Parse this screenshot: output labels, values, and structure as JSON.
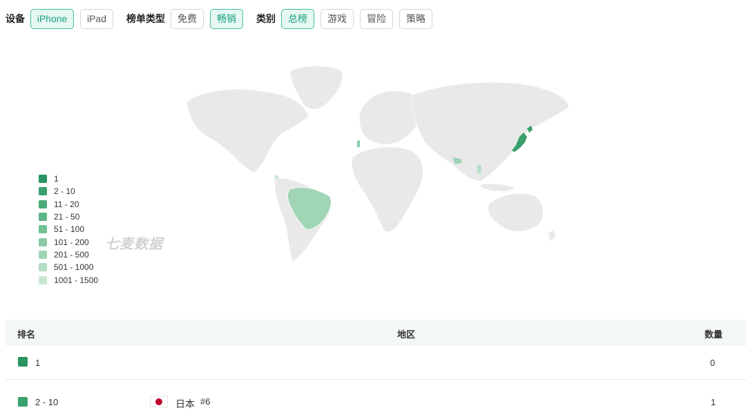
{
  "filters": {
    "device": {
      "label": "设备",
      "options": [
        "iPhone",
        "iPad"
      ],
      "selected": "iPhone"
    },
    "chart_type": {
      "label": "榜单类型",
      "options": [
        "免费",
        "畅销"
      ],
      "selected": "畅销"
    },
    "category": {
      "label": "类别",
      "options": [
        "总榜",
        "游戏",
        "冒险",
        "策略"
      ],
      "selected": "总榜"
    }
  },
  "legend": [
    {
      "label": "1",
      "color": "#2a9460"
    },
    {
      "label": "2 - 10",
      "color": "#3aa06c"
    },
    {
      "label": "11 - 20",
      "color": "#4aa977"
    },
    {
      "label": "21 - 50",
      "color": "#5db584"
    },
    {
      "label": "51 - 100",
      "color": "#73c095"
    },
    {
      "label": "101 - 200",
      "color": "#8acba5"
    },
    {
      "label": "201 - 500",
      "color": "#a0d5b6"
    },
    {
      "label": "501 - 1000",
      "color": "#b3dec5"
    },
    {
      "label": "1001 - 1500",
      "color": "#c8e8d6"
    }
  ],
  "watermark": "七麦数据",
  "table": {
    "headers": {
      "rank": "排名",
      "region": "地区",
      "count": "数量"
    },
    "rows": [
      {
        "rank": "1",
        "color": "#2a9460",
        "region": "",
        "region_rank": "",
        "count": "0"
      },
      {
        "rank": "2 - 10",
        "color": "#3aa06c",
        "region": "日本",
        "region_rank": "#6",
        "count": "1"
      }
    ]
  }
}
